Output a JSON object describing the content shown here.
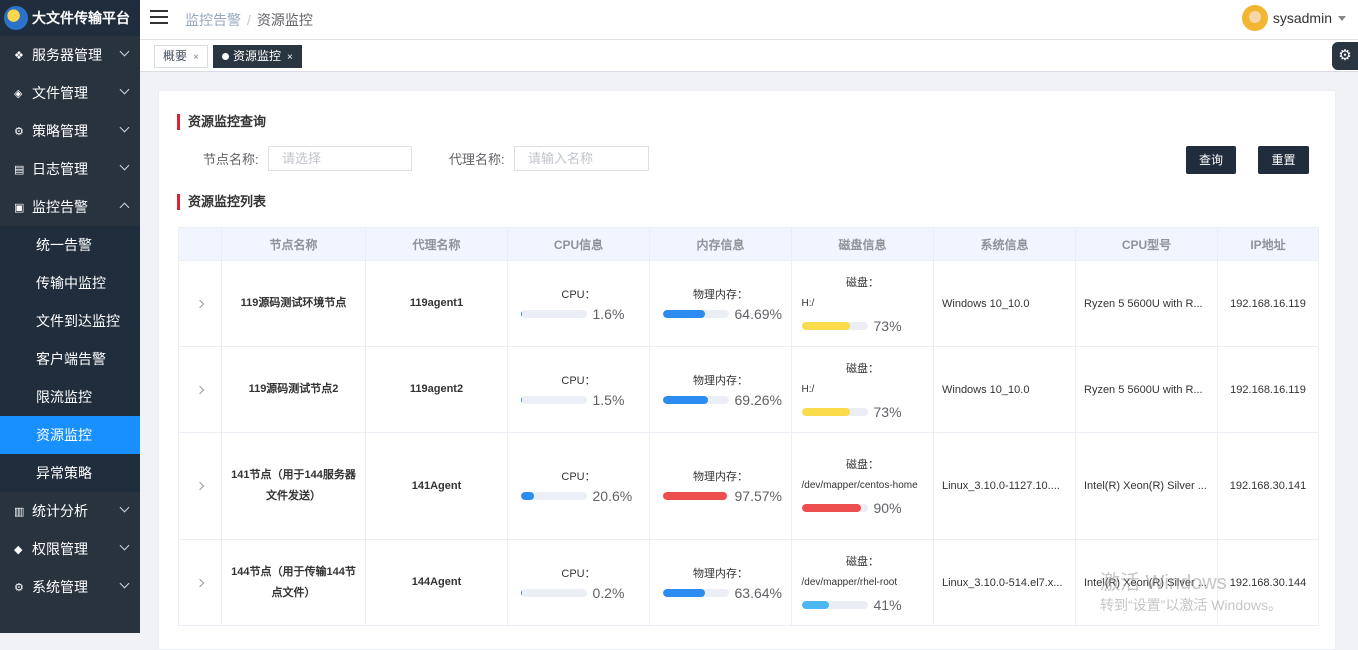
{
  "app": {
    "title": "大文件传输平台"
  },
  "sidebar": {
    "items": [
      {
        "label": "服务器管理",
        "icon": "cube-icon"
      },
      {
        "label": "文件管理",
        "icon": "layers-icon"
      },
      {
        "label": "策略管理",
        "icon": "gears-icon"
      },
      {
        "label": "日志管理",
        "icon": "log-icon"
      },
      {
        "label": "监控告警",
        "icon": "monitor-icon",
        "expanded": true
      }
    ],
    "submenu": [
      "统一告警",
      "传输中监控",
      "文件到达监控",
      "客户端告警",
      "限流监控",
      "资源监控",
      "异常策略"
    ],
    "items_after": [
      {
        "label": "统计分析",
        "icon": "chart-icon"
      },
      {
        "label": "权限管理",
        "icon": "shield-icon"
      },
      {
        "label": "系统管理",
        "icon": "settings-icon"
      }
    ]
  },
  "header": {
    "breadcrumb": [
      "监控告警",
      "资源监控"
    ],
    "user": "sysadmin"
  },
  "tabs": [
    {
      "label": "概要"
    },
    {
      "label": "资源监控",
      "active": true
    }
  ],
  "query": {
    "title": "资源监控查询",
    "node_label": "节点名称:",
    "node_placeholder": "请选择",
    "agent_label": "代理名称:",
    "agent_placeholder": "请输入名称",
    "search_btn": "查询",
    "reset_btn": "重置"
  },
  "list": {
    "title": "资源监控列表",
    "columns": [
      "节点名称",
      "代理名称",
      "CPU信息",
      "内存信息",
      "磁盘信息",
      "系统信息",
      "CPU型号",
      "IP地址"
    ],
    "cpu_label": "CPU：",
    "mem_label": "物理内存：",
    "disk_label": "磁盘：",
    "rows": [
      {
        "node": "119源码测试环境节点",
        "agent": "119agent1",
        "cpu": "1.6%",
        "cpu_pct": 1.6,
        "mem": "64.69%",
        "mem_pct": 64.69,
        "mem_color": "#2d8cf0",
        "disk_path": "H:/",
        "disk": "73%",
        "disk_pct": 73,
        "disk_color": "#fadb4a",
        "os": "Windows 10_10.0",
        "cpu_model": "Ryzen 5 5600U with R...",
        "ip": "192.168.16.119"
      },
      {
        "node": "119源码测试节点2",
        "agent": "119agent2",
        "cpu": "1.5%",
        "cpu_pct": 1.5,
        "mem": "69.26%",
        "mem_pct": 69.26,
        "mem_color": "#2d8cf0",
        "disk_path": "H:/",
        "disk": "73%",
        "disk_pct": 73,
        "disk_color": "#fadb4a",
        "os": "Windows 10_10.0",
        "cpu_model": "Ryzen 5 5600U with R...",
        "ip": "192.168.16.119"
      },
      {
        "node": "141节点（用于144服务器文件发送）",
        "agent": "141Agent",
        "cpu": "20.6%",
        "cpu_pct": 20.6,
        "mem": "97.57%",
        "mem_pct": 97.57,
        "mem_color": "#ed4e4e",
        "disk_path": "/dev/mapper/centos-home",
        "disk": "90%",
        "disk_pct": 90,
        "disk_color": "#ed4e4e",
        "os": "Linux_3.10.0-1127.10....",
        "cpu_model": "Intel(R) Xeon(R) Silver ...",
        "ip": "192.168.30.141"
      },
      {
        "node": "144节点（用于传输144节点文件）",
        "agent": "144Agent",
        "cpu": "0.2%",
        "cpu_pct": 0.2,
        "mem": "63.64%",
        "mem_pct": 63.64,
        "mem_color": "#2d8cf0",
        "disk_path": "/dev/mapper/rhel-root",
        "disk": "41%",
        "disk_pct": 41,
        "disk_color": "#4cb7f2",
        "os": "Linux_3.10.0-514.el7.x...",
        "cpu_model": "Intel(R) Xeon(R) Silver ...",
        "ip": "192.168.30.144"
      }
    ]
  },
  "watermark": {
    "line1": "激活 Windows",
    "line2": "转到“设置”以激活 Windows。"
  }
}
